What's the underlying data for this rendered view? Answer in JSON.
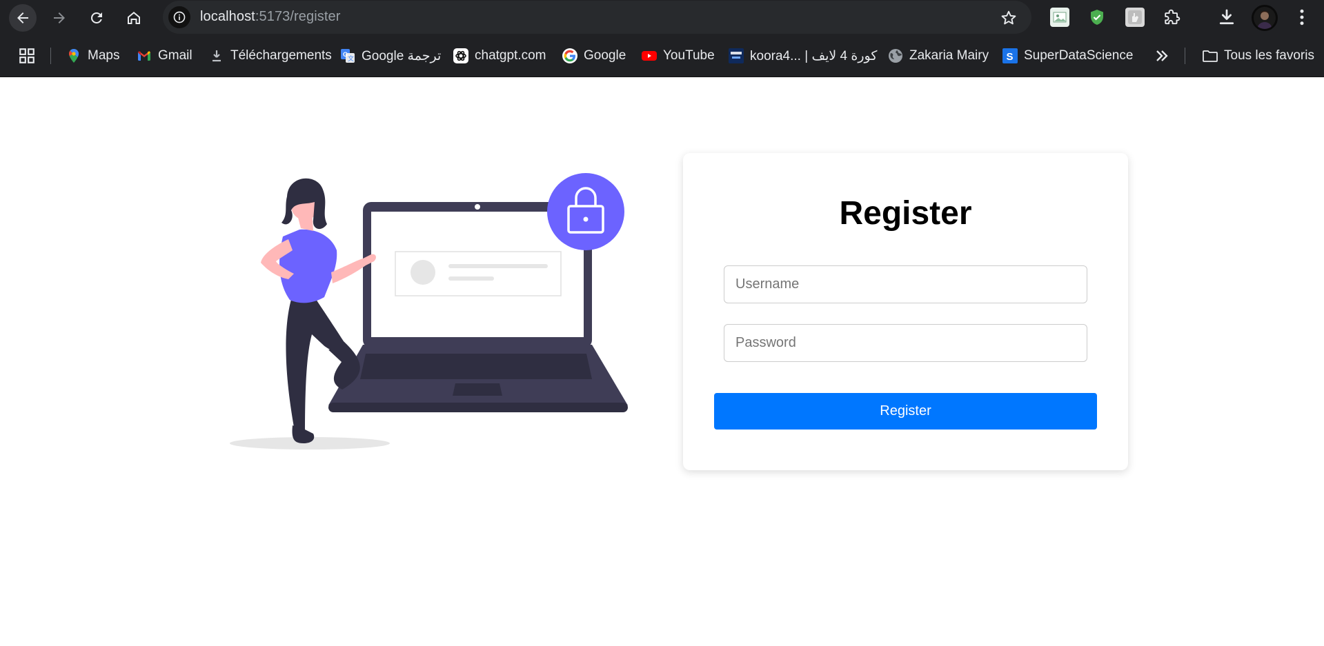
{
  "browser": {
    "url_host": "localhost",
    "url_path": ":5173/register",
    "icons": {
      "back": "back-arrow-icon",
      "forward": "forward-arrow-icon",
      "reload": "reload-icon",
      "home": "home-icon",
      "site_info": "info-icon",
      "bookmark_star": "star-icon",
      "downloads": "download-icon",
      "menu": "kebab-menu-icon"
    }
  },
  "bookmarks": {
    "items": [
      {
        "label": "Maps",
        "icon": "maps-pin-icon"
      },
      {
        "label": "Gmail",
        "icon": "gmail-icon"
      },
      {
        "label": "Téléchargements",
        "icon": "download-icon"
      },
      {
        "label": "Google ترجمة",
        "icon": "google-translate-icon"
      },
      {
        "label": "chatgpt.com",
        "icon": "chatgpt-icon"
      },
      {
        "label": "Google",
        "icon": "google-icon"
      },
      {
        "label": "YouTube",
        "icon": "youtube-icon"
      },
      {
        "label": "koora4... | كورة 4 لايف",
        "icon": "koora-icon"
      },
      {
        "label": "Zakaria Mairy",
        "icon": "globe-icon"
      },
      {
        "label": "SuperDataScience",
        "icon": "superdatascience-icon"
      }
    ],
    "all_bookmarks_label": "Tous les favoris"
  },
  "register": {
    "title": "Register",
    "username_placeholder": "Username",
    "password_placeholder": "Password",
    "submit_label": "Register"
  },
  "colors": {
    "browser_chrome": "#202124",
    "accent_button": "#0077ff",
    "illustration_purple": "#6c63ff",
    "laptop_dark": "#3f3d56"
  }
}
